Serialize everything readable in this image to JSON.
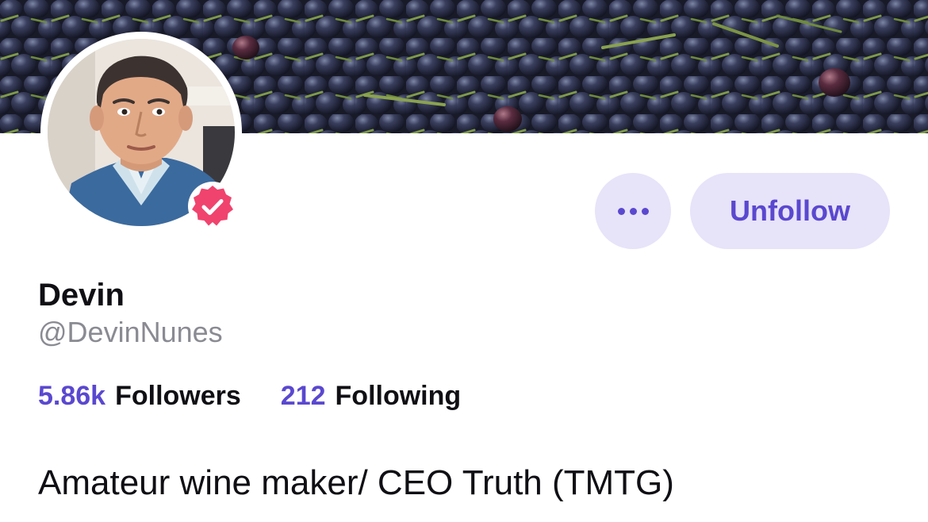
{
  "profile": {
    "display_name": "Devin",
    "handle": "@DevinNunes",
    "bio": "Amateur wine maker/ CEO Truth (TMTG)",
    "verified": true,
    "banner_image": "grapes-photo",
    "avatar_image": "profile-photo"
  },
  "stats": {
    "followers_count": "5.86k",
    "followers_label": "Followers",
    "following_count": "212",
    "following_label": "Following"
  },
  "actions": {
    "more_icon": "ellipsis-icon",
    "unfollow_label": "Unfollow"
  },
  "colors": {
    "accent": "#5a48cf",
    "button_bg": "#e7e3f9",
    "verified_badge": "#f0436d",
    "text_primary": "#0f0f14",
    "text_secondary": "#8a8a93"
  }
}
